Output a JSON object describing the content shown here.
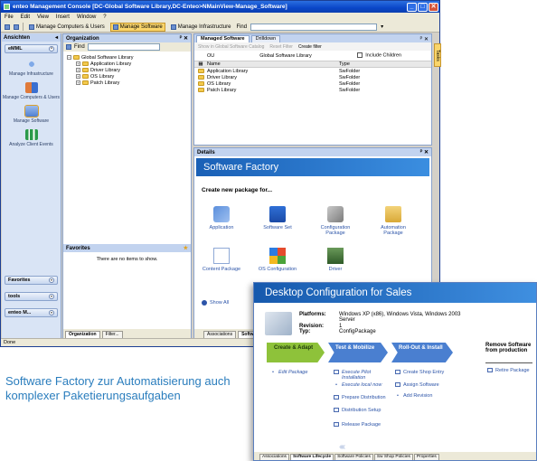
{
  "window": {
    "title": "enteo Management Console  [DC-Global Software Library,DC-Enteo>NMainView-Manage_Software]",
    "min": "_",
    "max": "□",
    "close": "✕"
  },
  "menu": [
    "File",
    "Edit",
    "View",
    "Insert",
    "Window",
    "?"
  ],
  "toolbar": {
    "manage_computers": "Manage Computers & Users",
    "manage_software": "Manage Software",
    "manage_infrastructure": "Manage Infrastructure",
    "find_label": "Find"
  },
  "nav": {
    "header": "Ansichten",
    "group_top": "eMML",
    "items": [
      {
        "label": "Manage Infrastructure"
      },
      {
        "label": "Manage Computers & Users"
      },
      {
        "label": "Manage Software"
      },
      {
        "label": "Analyze Client Events"
      }
    ],
    "bottom": [
      "Favorites",
      "tools",
      "enteo M..."
    ]
  },
  "organization": {
    "header": "Organization",
    "find_label": "Find",
    "tree_root": "Global Software Library",
    "tree_children": [
      "Application Library",
      "Driver Library",
      "OS Library",
      "Patch Library"
    ],
    "favorites_header": "Favorites",
    "favorites_empty": "There are no items to show.",
    "tabs": [
      "Organization",
      "Filter..."
    ]
  },
  "managed": {
    "tabs": [
      "Managed Software",
      "Drilldown"
    ],
    "toolbar": [
      "Show in Global Software Catalog",
      "Reset Filter",
      "Create filter"
    ],
    "ou_label": "OU",
    "ou_value": "Global Software Library",
    "include_children": "Include Children",
    "col_name": "Name",
    "col_type": "Type",
    "rows": [
      {
        "name": "Application Library",
        "type": "SwFolder"
      },
      {
        "name": "Driver Library",
        "type": "SwFolder"
      },
      {
        "name": "OS Library",
        "type": "SwFolder"
      },
      {
        "name": "Patch Library",
        "type": "SwFolder"
      }
    ]
  },
  "tasks_strip": "Tasks",
  "details": {
    "header": "Details",
    "banner": "Software Factory",
    "subtitle": "Create new package for...",
    "items": [
      {
        "label": "Application"
      },
      {
        "label": "Software Set"
      },
      {
        "label": "Configuration Package"
      },
      {
        "label": "Automation Package"
      },
      {
        "label": "Content Package"
      },
      {
        "label": "OS Configuration"
      },
      {
        "label": "Driver"
      }
    ],
    "show_all": "Show All",
    "tabs": [
      "Associations",
      "Softw"
    ]
  },
  "status": "Done",
  "overlay": {
    "banner": "Desktop Configuration for Sales",
    "platforms_label": "Platforms:",
    "platforms_value": "Windows XP (x86), Windows Vista, Windows 2003 Server",
    "revision_label": "Revision:",
    "revision_value": "1",
    "typ_label": "Typ:",
    "typ_value": "ConfigPackage",
    "stage1": "Create & Adapt",
    "stage2": "Test & Mobilize",
    "stage3": "Roll-Out & Install",
    "remove_title": "Remove Software from production",
    "tasks_stage1": [
      "Edit Package"
    ],
    "tasks_stage2": [
      "Execute Pilot Installation",
      "Execute local now",
      "Prepare Distribution",
      "Distribution Setup",
      "Release Package"
    ],
    "tasks_stage3": [
      "Create Shop Entry",
      "Assign Software",
      "Add Revision"
    ],
    "tasks_remove": [
      "Retire Package"
    ],
    "tabs": [
      "Associations",
      "Software Lifecycle",
      "Software Policies",
      "Sw Shop Policies",
      "Properties"
    ]
  },
  "caption": "Software Factory zur Automatisierung auch komplexer Paketierungsaufgaben"
}
